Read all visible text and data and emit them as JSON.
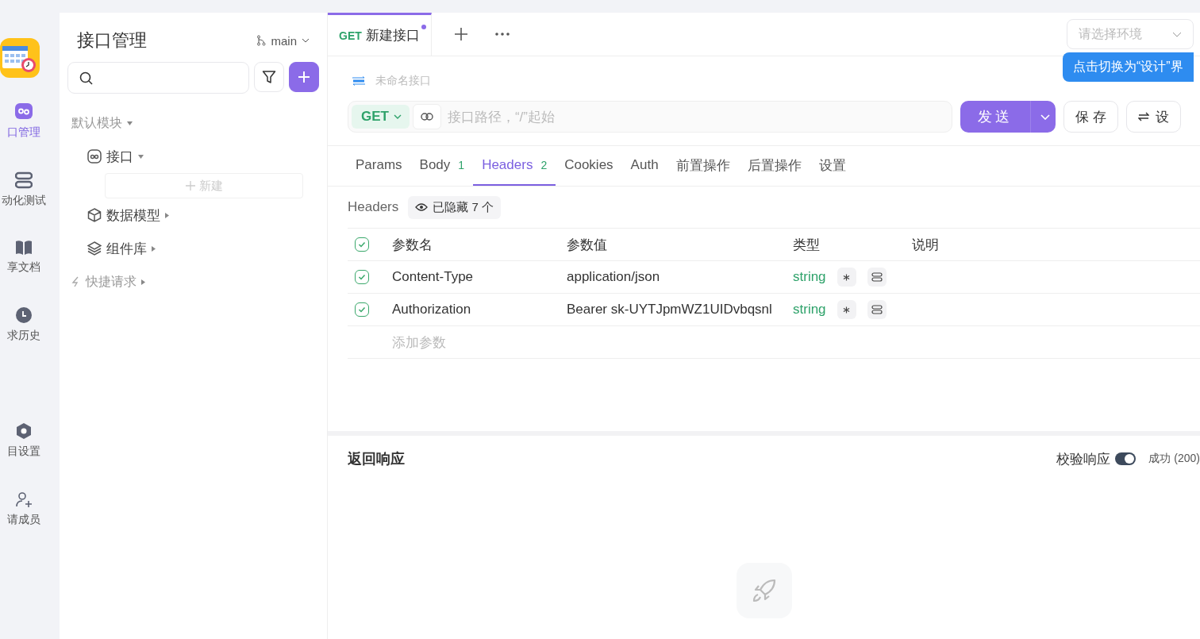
{
  "rail": {
    "items": [
      {
        "label": "口管理",
        "kind": "api",
        "selected": true
      },
      {
        "label": "动化测试",
        "kind": "test",
        "selected": false
      },
      {
        "label": "享文档",
        "kind": "docs",
        "selected": false
      },
      {
        "label": "求历史",
        "kind": "history",
        "selected": false
      },
      {
        "label": "目设置",
        "kind": "settings",
        "selected": false
      },
      {
        "label": "请成员",
        "kind": "invite",
        "selected": false
      }
    ]
  },
  "sidebar": {
    "title": "接口管理",
    "branch": "main",
    "tree": [
      {
        "label": "默认模块",
        "kind": "group",
        "expanded": true,
        "children": [
          {
            "label": "接口",
            "kind": "api",
            "expanded": true,
            "action": "新建"
          },
          {
            "label": "数据模型",
            "kind": "model",
            "expanded": false
          },
          {
            "label": "组件库",
            "kind": "components",
            "expanded": false
          }
        ]
      },
      {
        "label": "快捷请求",
        "kind": "quick",
        "expanded": false
      }
    ]
  },
  "tabs": [
    {
      "method": "GET",
      "title": "新建接口",
      "modified": true,
      "selected": true
    }
  ],
  "environment": {
    "placeholder": "请选择环境"
  },
  "tooltip": "点击切换为“设计”界",
  "request": {
    "name_placeholder": "未命名接口",
    "method": "GET",
    "path_placeholder": "接口路径，“/”起始",
    "send": "发送",
    "save": "保 存",
    "design": "设"
  },
  "sub_tabs": [
    {
      "label": "Params",
      "selected": false
    },
    {
      "label": "Body",
      "count": "1",
      "selected": false
    },
    {
      "label": "Headers",
      "count": "2",
      "selected": true
    },
    {
      "label": "Cookies",
      "selected": false
    },
    {
      "label": "Auth",
      "selected": false
    },
    {
      "label": "前置操作",
      "selected": false
    },
    {
      "label": "后置操作",
      "selected": false
    },
    {
      "label": "设置",
      "selected": false
    }
  ],
  "headers": {
    "label": "Headers",
    "hidden": "已隐藏 7 个",
    "all_checked": true,
    "columns": [
      "参数名",
      "参数值",
      "类型",
      "说明"
    ],
    "rows": [
      {
        "checked": true,
        "name": "Content-Type",
        "value": "application/json",
        "type": "string"
      },
      {
        "checked": true,
        "name": "Authorization",
        "value": "Bearer sk-UYTJpmWZ1UIDvbqsnl",
        "type": "string"
      }
    ],
    "add_placeholder": "添加参数"
  },
  "response": {
    "title": "返回响应",
    "validate_label": "校验响应",
    "validate_on": true,
    "status": "成功 (200)"
  }
}
